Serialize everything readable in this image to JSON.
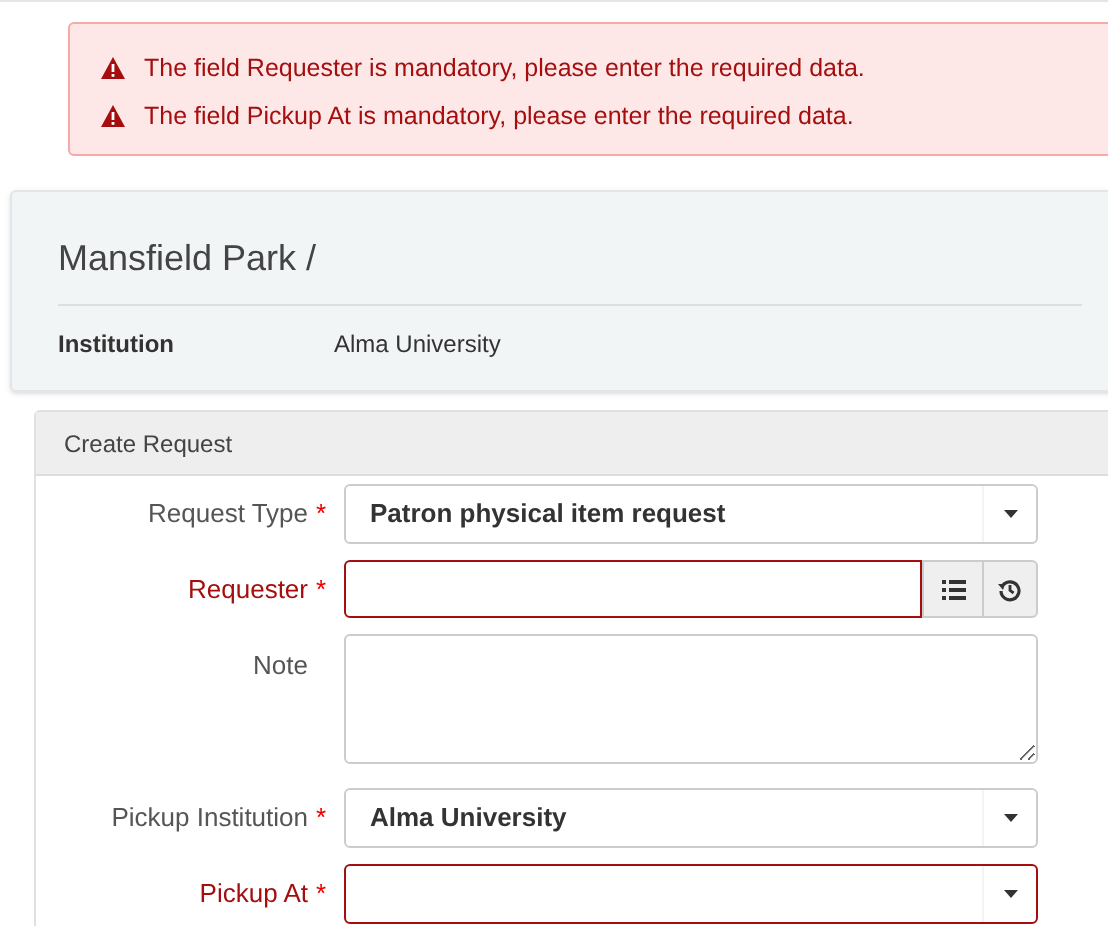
{
  "alerts": [
    "The field Requester is mandatory, please enter the required data.",
    "The field Pickup At is mandatory, please enter the required data."
  ],
  "record": {
    "title": "Mansfield Park /",
    "details": [
      {
        "label": "Institution",
        "value": "Alma University"
      }
    ]
  },
  "form": {
    "title": "Create Request",
    "fields": [
      {
        "kind": "select",
        "label": "Request Type",
        "marker": "*",
        "error": false,
        "value": "Patron physical item request"
      },
      {
        "kind": "lookup",
        "label": "Requester",
        "marker": "*",
        "error": true
      },
      {
        "kind": "textarea",
        "label": "Note",
        "error": false
      },
      {
        "kind": "select",
        "label": "Pickup Institution",
        "marker": "*",
        "error": false,
        "value": "Alma University"
      },
      {
        "kind": "select",
        "label": "Pickup At",
        "marker": "*",
        "error": true
      }
    ]
  }
}
